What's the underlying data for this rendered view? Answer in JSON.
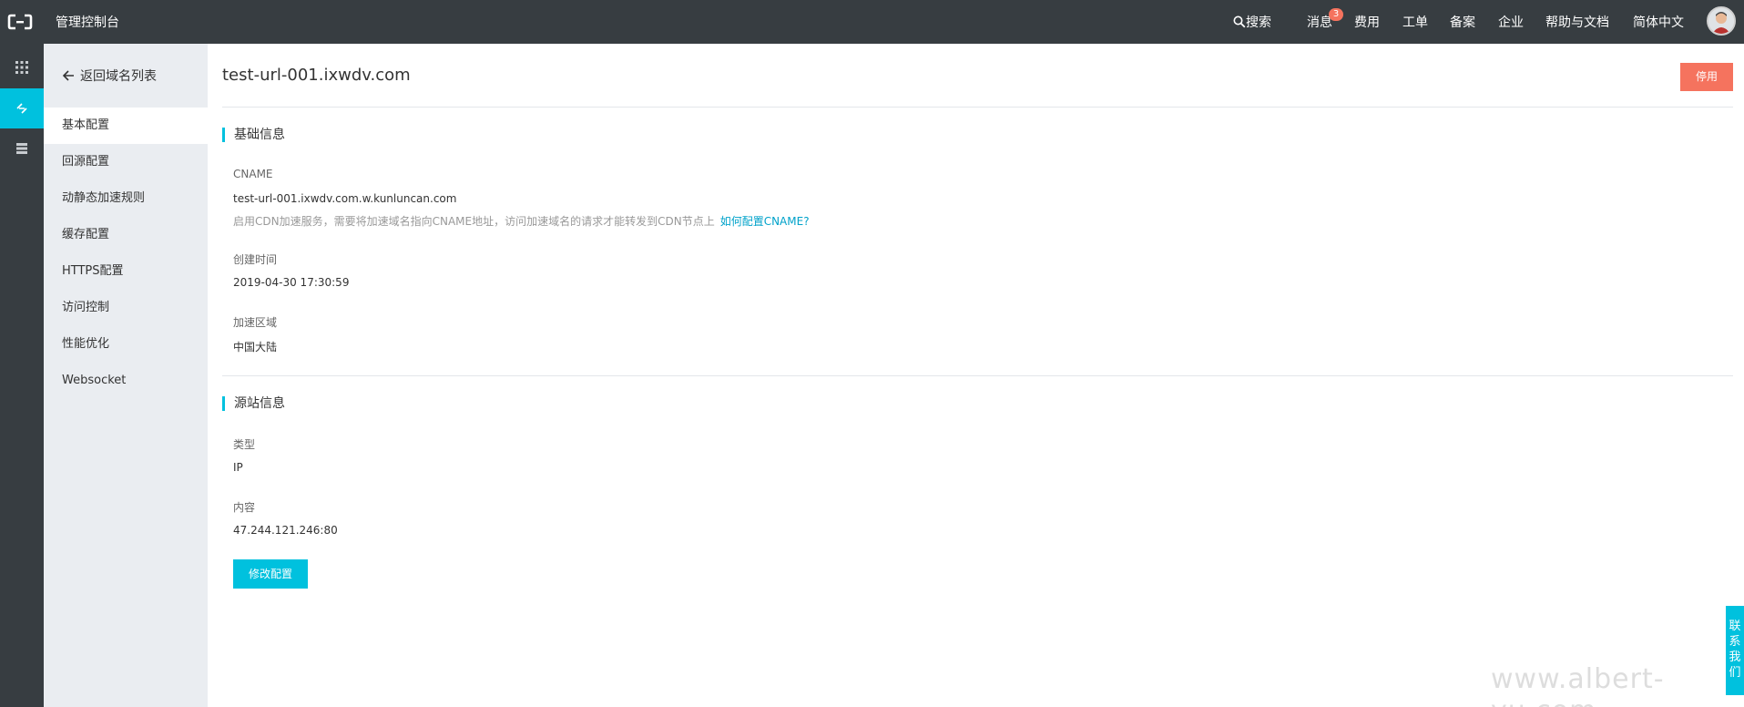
{
  "topbar": {
    "console_title": "管理控制台",
    "search": "搜索",
    "messages": "消息",
    "message_badge": "3",
    "fees": "费用",
    "tickets": "工单",
    "filing": "备案",
    "enterprise": "企业",
    "help": "帮助与文档",
    "language": "简体中文"
  },
  "subnav": {
    "back": "返回域名列表",
    "items": [
      {
        "label": "基本配置"
      },
      {
        "label": "回源配置"
      },
      {
        "label": "动静态加速规则"
      },
      {
        "label": "缓存配置"
      },
      {
        "label": "HTTPS配置"
      },
      {
        "label": "访问控制"
      },
      {
        "label": "性能优化"
      },
      {
        "label": "Websocket"
      }
    ]
  },
  "main": {
    "domain": "test-url-001.ixwdv.com",
    "disable_label": "停用",
    "basic": {
      "title": "基础信息",
      "cname_label": "CNAME",
      "cname_value": "test-url-001.ixwdv.com.w.kunluncan.com",
      "cname_hint": "启用CDN加速服务，需要将加速域名指向CNAME地址，访问加速域名的请求才能转发到CDN节点上",
      "cname_link": "如何配置CNAME?",
      "created_label": "创建时间",
      "created_value": "2019-04-30 17:30:59",
      "region_label": "加速区域",
      "region_value": "中国大陆"
    },
    "origin": {
      "title": "源站信息",
      "type_label": "类型",
      "type_value": "IP",
      "content_label": "内容",
      "content_value": "47.244.121.246:80",
      "modify_label": "修改配置"
    }
  },
  "contact": "联系我们",
  "watermark": "www.albert-yu.com",
  "colors": {
    "topbar": "#373d41",
    "accent": "#00c1de",
    "danger": "#f5735e",
    "subnav_bg": "#eaedf1",
    "link": "#00a2ca"
  }
}
